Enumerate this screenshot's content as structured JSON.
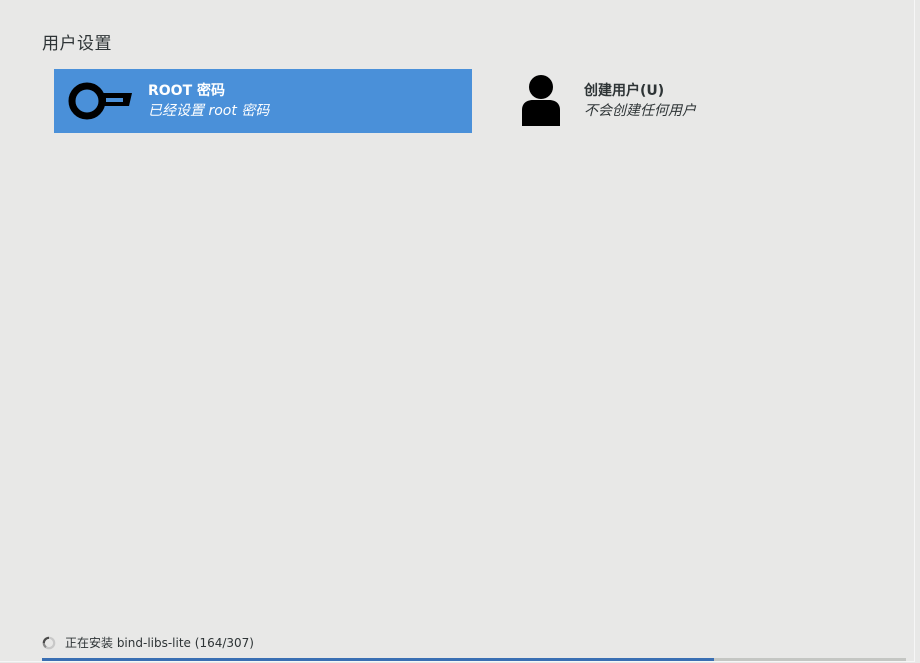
{
  "section": {
    "title": "用户设置"
  },
  "spokes": {
    "root": {
      "title": "ROOT 密码",
      "status": "已经设置 root 密码",
      "icon": "key-icon",
      "selected": true
    },
    "user": {
      "title": "创建用户(U)",
      "status": "不会创建任何用户",
      "icon": "user-icon",
      "selected": false
    }
  },
  "footer": {
    "status_text": "正在安装 bind-libs-lite (164/307)",
    "progress": {
      "current": 164,
      "total": 307,
      "fraction": 0.778
    }
  },
  "colors": {
    "background": "#e8e8e7",
    "selected": "#4a90d9",
    "progress": "#3a6fb3",
    "text": "#2e3436"
  }
}
